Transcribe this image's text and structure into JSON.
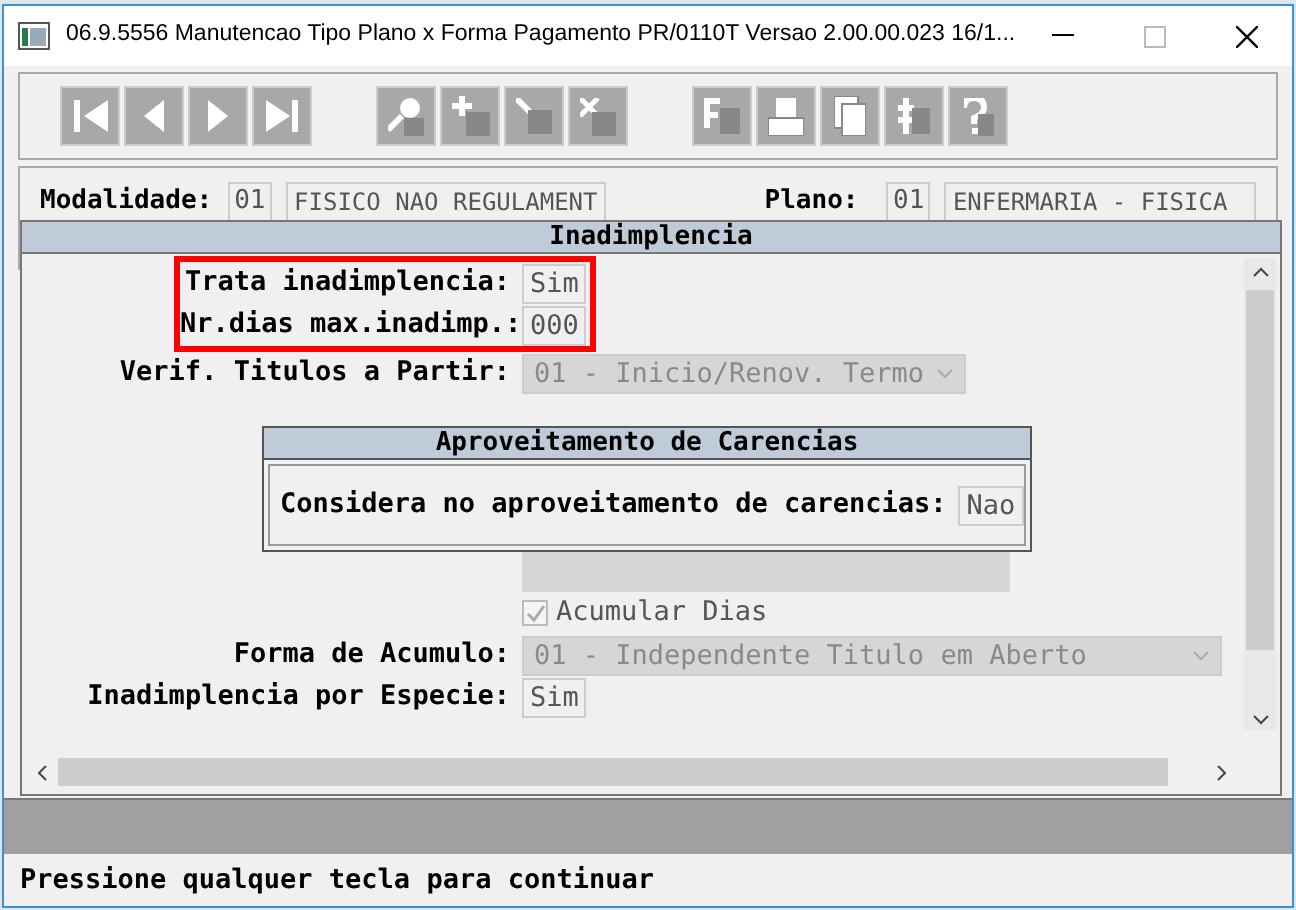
{
  "window": {
    "title": "06.9.5556 Manutencao  Tipo Plano x Forma Pagamento PR/0110T Versao 2.00.00.023 16/1..."
  },
  "header_fields": [
    {
      "label": "Modalidade:",
      "code": "01",
      "value": "FISICO NAO REGULAMENT"
    },
    {
      "label": "Plano:",
      "code": "01",
      "value": "ENFERMARIA - FISICA"
    }
  ],
  "dialog": {
    "title": "Inadimplencia",
    "fields": [
      {
        "kind": "value",
        "label": "Trata inadimplencia:",
        "value": "Sim",
        "highlighted": true
      },
      {
        "kind": "value",
        "label": "Nr.dias max.inadimp.:",
        "value": "000",
        "highlighted": true
      },
      {
        "kind": "select",
        "label": "Verif. Titulos a Partir:",
        "value": "01 - Inicio/Renov. Termo",
        "disabled": true
      },
      {
        "kind": "spacer"
      },
      {
        "kind": "covered_select"
      },
      {
        "kind": "checkbox",
        "label": "Acumular Dias",
        "checked": true,
        "disabled": true
      },
      {
        "kind": "select",
        "label": "Forma de Acumulo:",
        "value": "01 - Independente Titulo em Aberto",
        "disabled": true,
        "wide": true
      },
      {
        "kind": "value",
        "label": "Inadimplencia por Especie:",
        "value": "Sim"
      }
    ]
  },
  "popup": {
    "title": "Aproveitamento de Carencias",
    "label": "Considera no aproveitamento de carencias:",
    "value": "Nao"
  },
  "status_bar": "Pressione qualquer tecla para continuar"
}
